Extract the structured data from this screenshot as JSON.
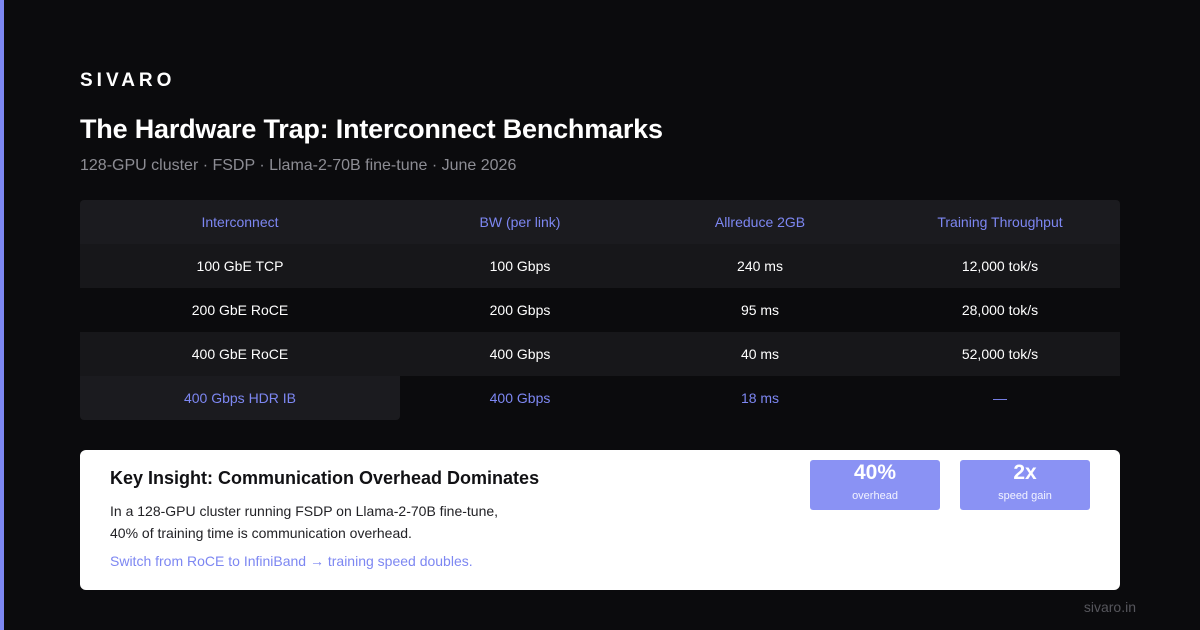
{
  "brand": "SIVARO",
  "title": "The Hardware Trap: Interconnect Benchmarks",
  "subtitle": "128-GPU cluster · FSDP · Llama-2-70B fine-tune · June 2026",
  "table": {
    "headers": [
      "Interconnect",
      "BW (per link)",
      "Allreduce 2GB",
      "Training Throughput"
    ],
    "rows": [
      [
        "100 GbE TCP",
        "100 Gbps",
        "240 ms",
        "12,000 tok/s"
      ],
      [
        "200 GbE RoCE",
        "200 Gbps",
        "95 ms",
        "28,000 tok/s"
      ],
      [
        "400 GbE RoCE",
        "400 Gbps",
        "40 ms",
        "52,000 tok/s"
      ],
      [
        "400 Gbps HDR IB",
        "400 Gbps",
        "18 ms",
        "—"
      ]
    ]
  },
  "insight": {
    "title": "Key Insight: Communication Overhead Dominates",
    "body_line1": "In a 128-GPU cluster running FSDP on Llama-2-70B fine-tune,",
    "body_line2": "40% of training time is communication overhead.",
    "cta": "Switch from RoCE to InfiniBand → training speed doubles.",
    "stats": [
      {
        "value": "40%",
        "label": "overhead"
      },
      {
        "value": "2x",
        "label": "speed gain"
      }
    ]
  },
  "footer": "sivaro.in",
  "colors": {
    "background": "#0b0b0d",
    "accent": "#7d87f2",
    "stat_fill": "#8a92f4",
    "card": "#ffffff"
  }
}
